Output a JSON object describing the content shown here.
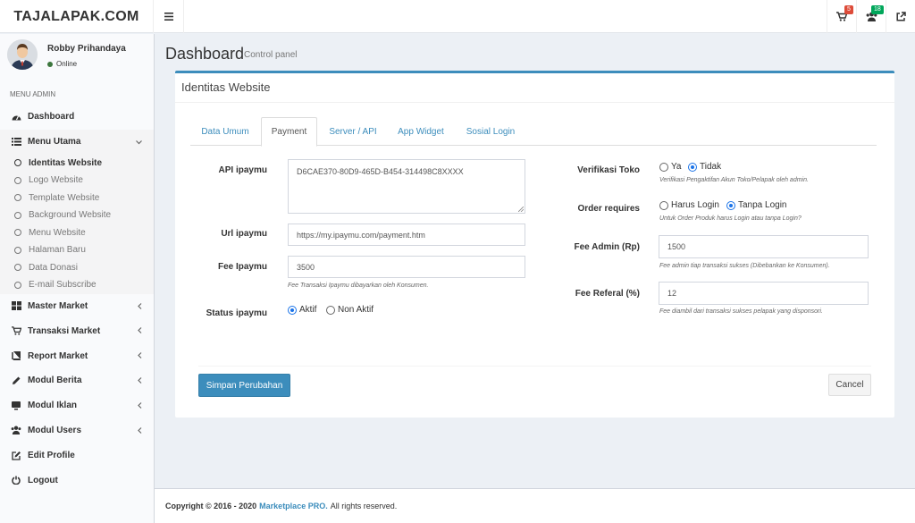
{
  "brand": {
    "logo": "TAJALAPAK.COM"
  },
  "topbar": {
    "cart_badge": "5",
    "users_badge": "18"
  },
  "user": {
    "name": "Robby Prihandaya",
    "status": "Online"
  },
  "sidebar": {
    "header": "MENU ADMIN",
    "dashboard": "Dashboard",
    "menu_utama": "Menu Utama",
    "sub_items": [
      "Identitas Website",
      "Logo Website",
      "Template Website",
      "Background Website",
      "Menu Website",
      "Halaman Baru",
      "Data Donasi",
      "E-mail Subscribe"
    ],
    "master_market": "Master Market",
    "transaksi_market": "Transaksi Market",
    "report_market": "Report Market",
    "modul_berita": "Modul Berita",
    "modul_iklan": "Modul Iklan",
    "modul_users": "Modul Users",
    "edit_profile": "Edit Profile",
    "logout": "Logout"
  },
  "page": {
    "title": "Dashboard",
    "subtitle": "Control panel"
  },
  "box": {
    "title": "Identitas Website"
  },
  "tabs": [
    "Data Umum",
    "Payment",
    "Server / API",
    "App Widget",
    "Sosial Login"
  ],
  "form": {
    "api_label": "API ipaymu",
    "api_value": "D6CAE370-80D9-465D-B454-314498C8XXXX",
    "url_label": "Url ipaymu",
    "url_value": "https://my.ipaymu.com/payment.htm",
    "fee_label": "Fee Ipaymu",
    "fee_value": "3500",
    "fee_help": "Fee Transaksi Ipaymu dibayarkan oleh Konsumen.",
    "status_label": "Status ipaymu",
    "status_aktif": "Aktif",
    "status_non": "Non Aktif",
    "verif_label": "Verifikasi Toko",
    "verif_ya": "Ya",
    "verif_tidak": "Tidak",
    "verif_help": "Verifikasi Pengaktifan Akun Toko/Pelapak oleh admin.",
    "order_label": "Order requires",
    "order_harus": "Harus Login",
    "order_tanpa": "Tanpa Login",
    "order_help": "Untuk Order Produk harus Login atau tanpa Login?",
    "admin_label": "Fee Admin (Rp)",
    "admin_value": "1500",
    "admin_help": "Fee admin tiap transaksi sukses (Dibebankan ke Konsumen).",
    "referal_label": "Fee Referal (%)",
    "referal_value": "12",
    "referal_help": "Fee diambil dari transaksi sukses pelapak yang disponsori."
  },
  "buttons": {
    "save": "Simpan Perubahan",
    "cancel": "Cancel"
  },
  "footer": {
    "copyright": "Copyright © 2016 - 2020",
    "brand": "Marketplace PRO.",
    "rights": "All rights reserved."
  }
}
